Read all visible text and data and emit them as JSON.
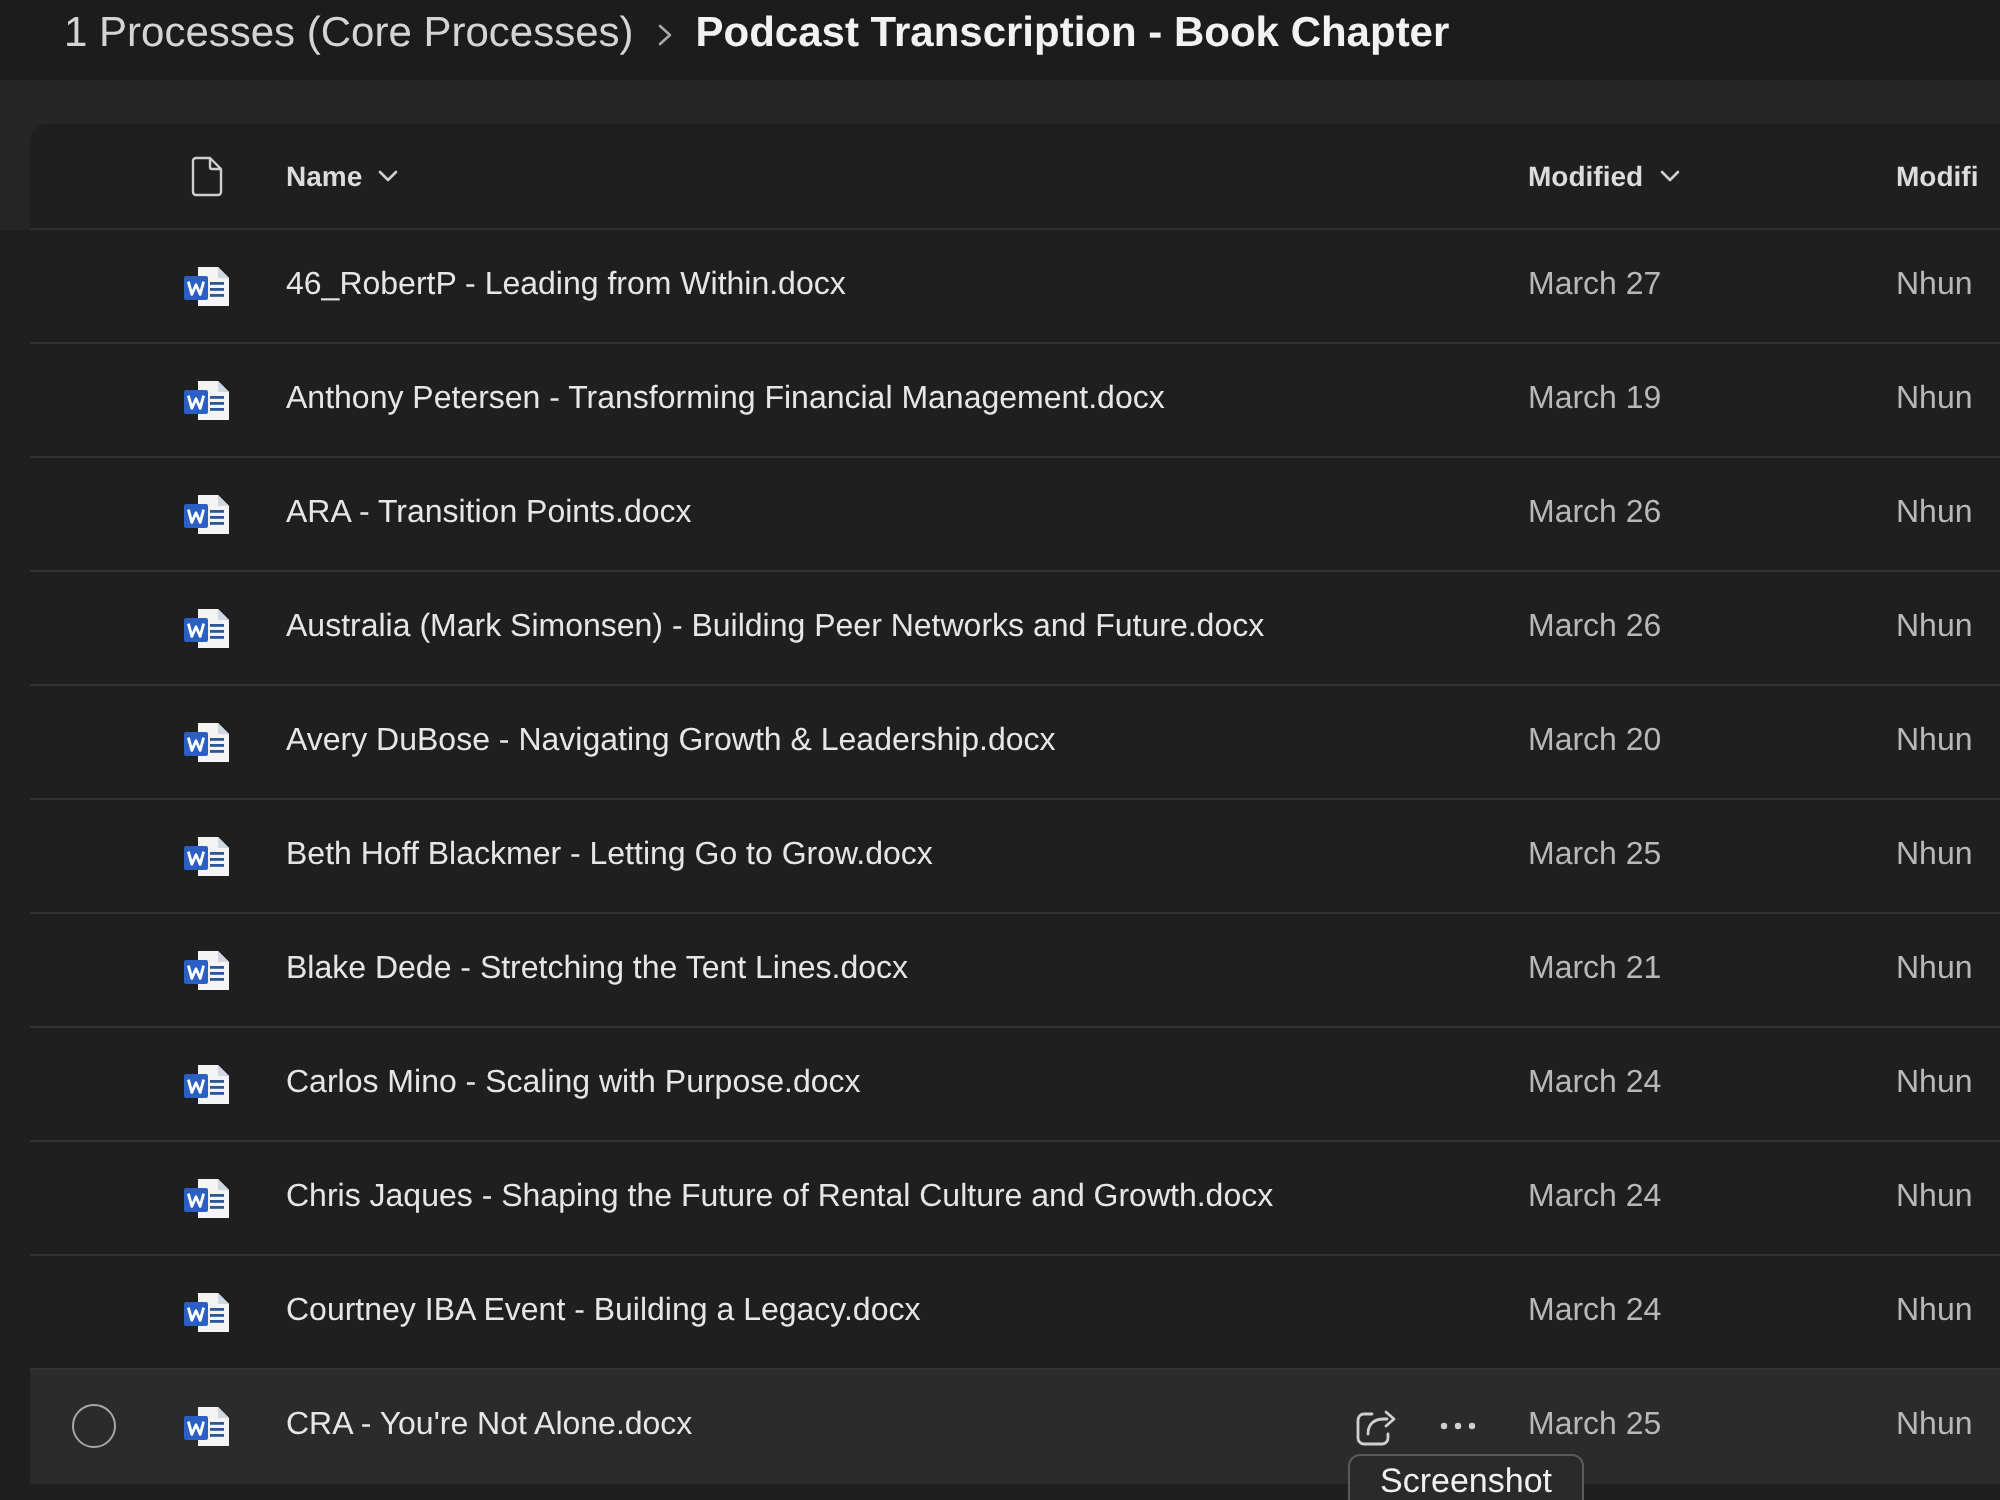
{
  "breadcrumb": [
    {
      "label": "1 Processes (Core Processes)",
      "current": false
    },
    {
      "label": "Podcast Transcription - Book Chapter",
      "current": true
    }
  ],
  "table": {
    "columns": [
      {
        "label": "Name",
        "menu": true
      },
      {
        "label": "Modified",
        "menu": true
      },
      {
        "label": "Modifi",
        "menu": false
      }
    ],
    "rows": [
      {
        "name": "46_RobertP - Leading from Within.docx",
        "modified": "March 27",
        "modified_by": "Nhun",
        "selected": false,
        "hovered": false
      },
      {
        "name": "Anthony Petersen - Transforming Financial Management.docx",
        "modified": "March 19",
        "modified_by": "Nhun",
        "selected": false,
        "hovered": false
      },
      {
        "name": "ARA - Transition Points.docx",
        "modified": "March 26",
        "modified_by": "Nhun",
        "selected": false,
        "hovered": false
      },
      {
        "name": "Australia (Mark Simonsen) - Building Peer Networks and Future.docx",
        "modified": "March 26",
        "modified_by": "Nhun",
        "selected": false,
        "hovered": false
      },
      {
        "name": "Avery DuBose - Navigating Growth & Leadership.docx",
        "modified": "March 20",
        "modified_by": "Nhun",
        "selected": false,
        "hovered": false
      },
      {
        "name": "Beth Hoff Blackmer - Letting Go to Grow.docx",
        "modified": "March 25",
        "modified_by": "Nhun",
        "selected": false,
        "hovered": false
      },
      {
        "name": "Blake Dede - Stretching the Tent Lines.docx",
        "modified": "March 21",
        "modified_by": "Nhun",
        "selected": false,
        "hovered": false
      },
      {
        "name": "Carlos Mino - Scaling with Purpose.docx",
        "modified": "March 24",
        "modified_by": "Nhun",
        "selected": false,
        "hovered": false
      },
      {
        "name": "Chris Jaques - Shaping the Future of Rental Culture and Growth.docx",
        "modified": "March 24",
        "modified_by": "Nhun",
        "selected": false,
        "hovered": false
      },
      {
        "name": "Courtney IBA Event - Building a Legacy.docx",
        "modified": "March 24",
        "modified_by": "Nhun",
        "selected": false,
        "hovered": false
      },
      {
        "name": "CRA - You're Not Alone.docx",
        "modified": "March 25",
        "modified_by": "Nhun",
        "selected": false,
        "hovered": true
      }
    ]
  },
  "tooltip": {
    "text": "Screenshot"
  }
}
